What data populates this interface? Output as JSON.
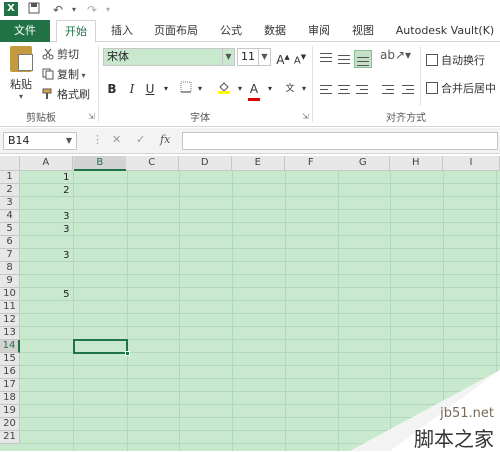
{
  "qat": {
    "icons": [
      "excel-logo-icon",
      "save-icon",
      "undo-icon",
      "redo-icon"
    ],
    "excel_letter": "X"
  },
  "tabs": {
    "file": "文件",
    "items": [
      "开始",
      "插入",
      "页面布局",
      "公式",
      "数据",
      "审阅",
      "视图",
      "Autodesk Vault(K)"
    ]
  },
  "ribbon": {
    "clipboard": {
      "paste": "粘贴",
      "cut": "剪切",
      "copy": "复制",
      "format_painter": "格式刷",
      "group": "剪贴板"
    },
    "font": {
      "name": "宋体",
      "size": "11",
      "bold": "B",
      "italic": "I",
      "underline": "U",
      "font_color_letter": "A",
      "grow": "A",
      "shrink": "A",
      "wen": "文",
      "group": "字体"
    },
    "alignment": {
      "wrap": "自动换行",
      "merge": "合并后居中",
      "group": "对齐方式"
    }
  },
  "formula_bar": {
    "name_box": "B14",
    "fx": "fx",
    "cancel": "✕",
    "enter": "✓",
    "value": ""
  },
  "grid": {
    "columns": [
      "A",
      "B",
      "C",
      "D",
      "E",
      "F",
      "G",
      "H",
      "I"
    ],
    "selected_column": "B",
    "rows": [
      "1",
      "2",
      "3",
      "4",
      "5",
      "6",
      "7",
      "8",
      "9",
      "10",
      "11",
      "12",
      "13",
      "14",
      "15",
      "16",
      "17",
      "18",
      "19",
      "20",
      "21"
    ],
    "selected_row": "14",
    "cells": [
      {
        "row": 1,
        "col": "A",
        "value": "1"
      },
      {
        "row": 2,
        "col": "A",
        "value": "2"
      },
      {
        "row": 4,
        "col": "A",
        "value": "3"
      },
      {
        "row": 5,
        "col": "A",
        "value": "3"
      },
      {
        "row": 7,
        "col": "A",
        "value": "3"
      },
      {
        "row": 10,
        "col": "A",
        "value": "5"
      }
    ]
  },
  "watermark": {
    "url": "jb51.net",
    "name": "脚本之家"
  },
  "colors": {
    "accent": "#217346",
    "grid_fill": "#c9e9cf"
  }
}
